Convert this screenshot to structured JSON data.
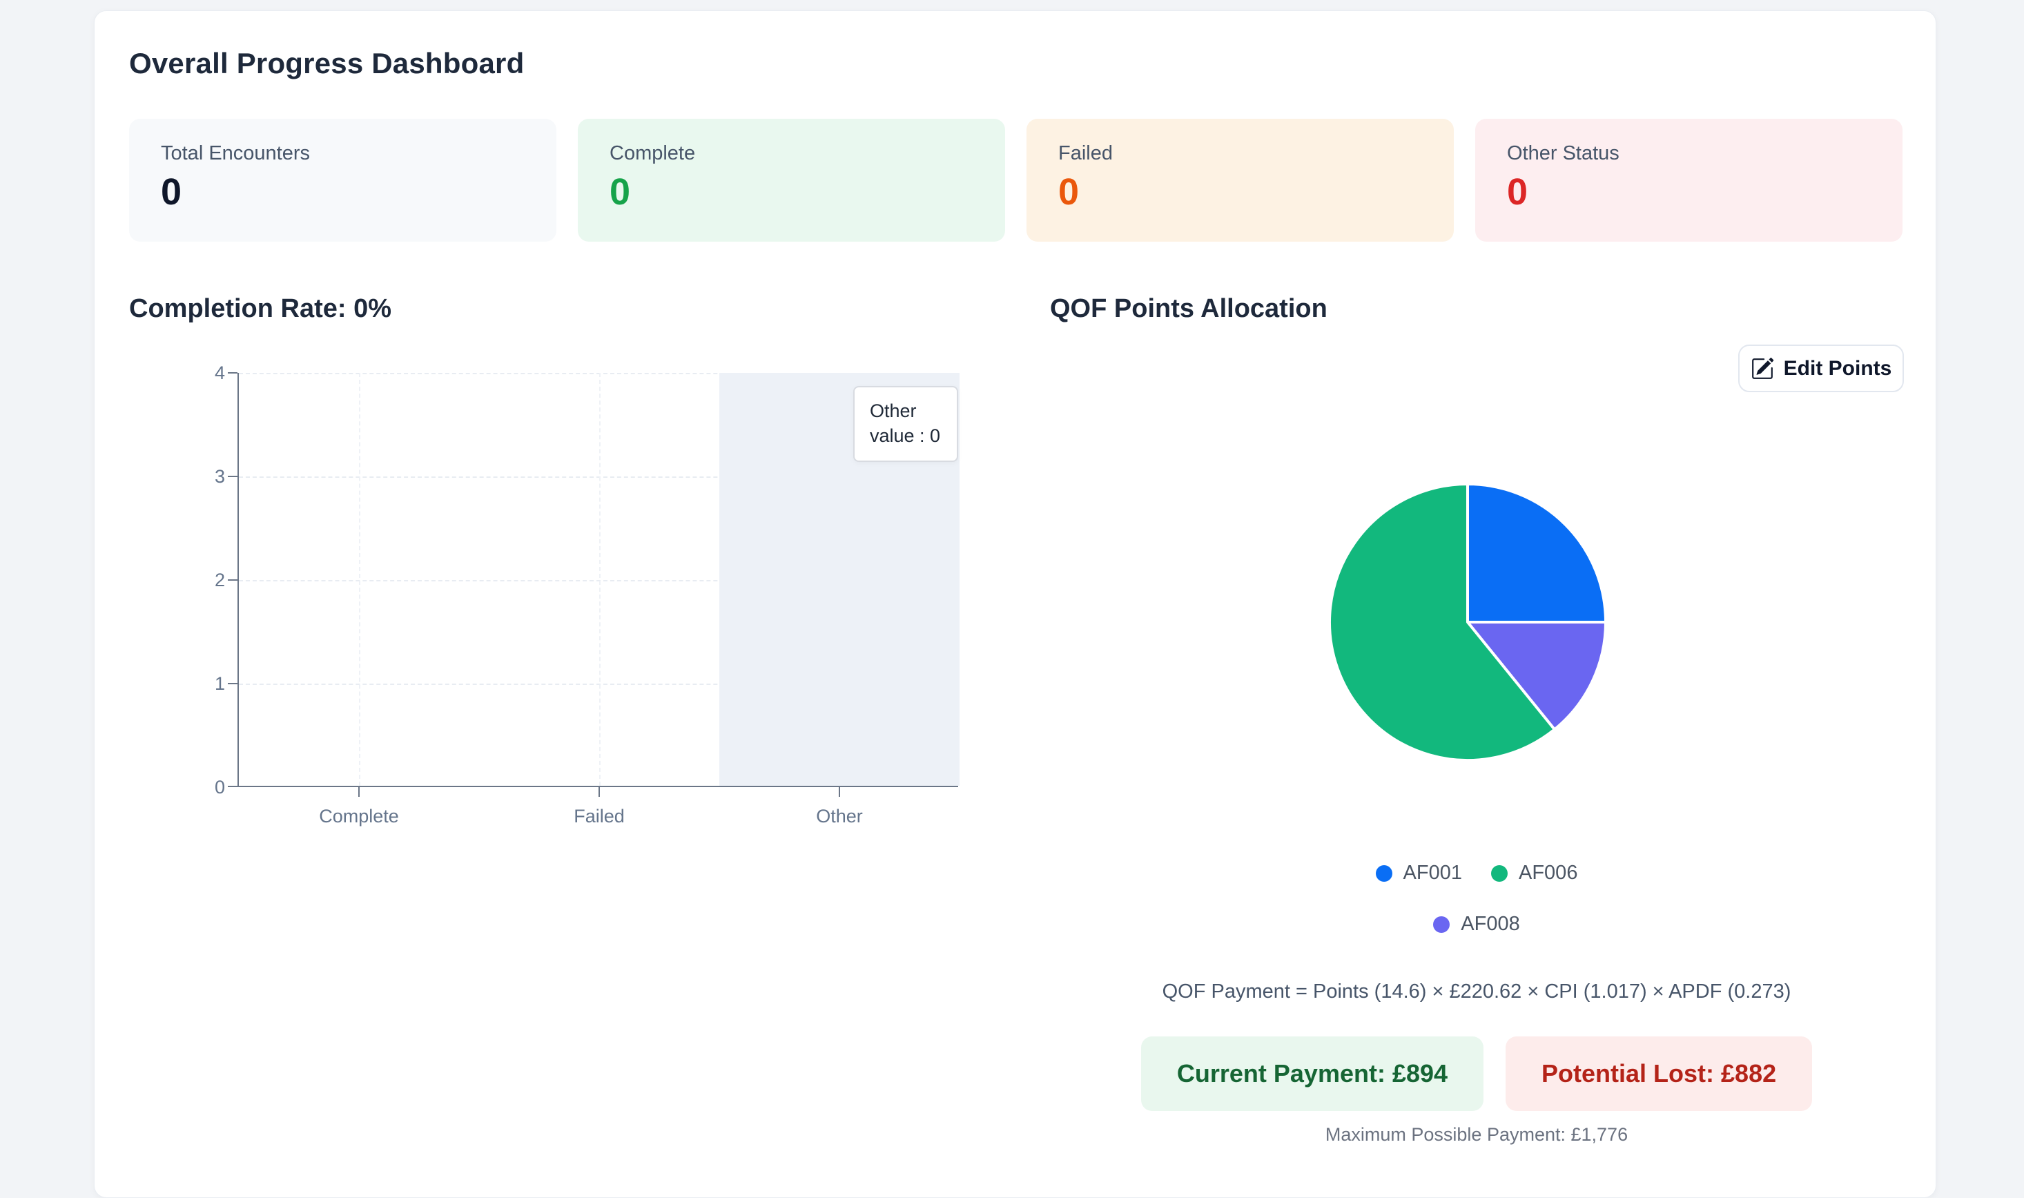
{
  "page": {
    "title": "Overall Progress Dashboard"
  },
  "colors": {
    "accent_blue": "#0a6ef5",
    "accent_green": "#12b87d",
    "accent_purple": "#6a66f1",
    "status_complete": "#16a34a",
    "status_failed": "#ea580c",
    "status_other": "#dc2626",
    "payment_current_text": "#166534",
    "payment_lost_text": "#b42318"
  },
  "stats": [
    {
      "label": "Total Encounters",
      "value": "0"
    },
    {
      "label": "Complete",
      "value": "0"
    },
    {
      "label": "Failed",
      "value": "0"
    },
    {
      "label": "Other Status",
      "value": "0"
    }
  ],
  "completion": {
    "heading": "Completion Rate: 0%"
  },
  "qof": {
    "heading": "QOF Points Allocation",
    "edit_button_label": "Edit Points",
    "formula": "QOF Payment = Points (14.6) × £220.62 × CPI (1.017) × APDF (0.273)",
    "current_payment": "Current Payment: £894",
    "potential_lost": "Potential Lost: £882",
    "max_payment": "Maximum Possible Payment: £1,776"
  },
  "chart_data": [
    {
      "type": "bar",
      "title": "Completion Rate: 0%",
      "categories": [
        "Complete",
        "Failed",
        "Other"
      ],
      "values": [
        0,
        0,
        0
      ],
      "xlabel": "",
      "ylabel": "",
      "ylim": [
        0,
        4
      ],
      "yticks": [
        "0",
        "1",
        "2",
        "3",
        "4"
      ],
      "grid": true,
      "highlighted_category": "Other",
      "tooltip": {
        "title": "Other",
        "value_line": "value : 0"
      }
    },
    {
      "type": "pie",
      "title": "QOF Points Allocation",
      "series": [
        {
          "name": "AF001",
          "percent": 25.0,
          "color": "#0a6ef5"
        },
        {
          "name": "AF008",
          "percent": 14.2,
          "color": "#6a66f1"
        },
        {
          "name": "AF006",
          "percent": 60.8,
          "color": "#12b87d"
        }
      ],
      "legend": [
        {
          "label": "AF001",
          "color": "#0a6ef5"
        },
        {
          "label": "AF006",
          "color": "#12b87d"
        },
        {
          "label": "AF008",
          "color": "#6a66f1"
        }
      ],
      "legend_position": "bottom"
    }
  ]
}
